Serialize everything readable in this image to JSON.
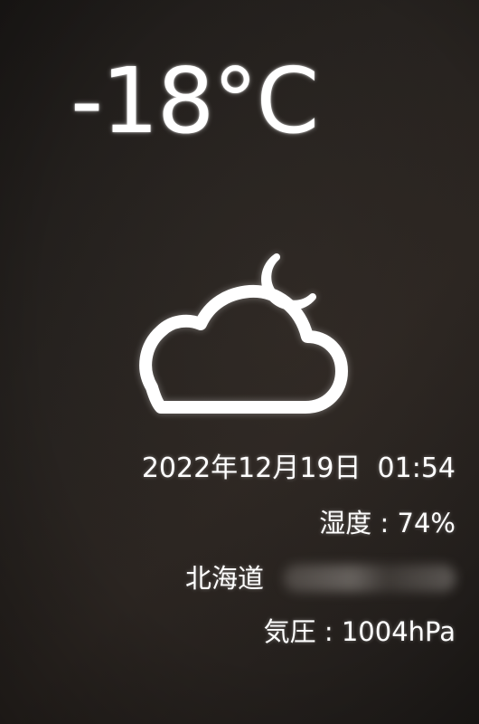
{
  "weather": {
    "temperature": "-18°C",
    "condition_icon": "cloud-moon-icon",
    "date": "2022年12月19日",
    "time": "01:54",
    "humidity_label": "湿度",
    "humidity_value": "74%",
    "location": "北海道",
    "pressure_label": "気圧",
    "pressure_value": "1004hPa"
  },
  "colors": {
    "text": "#ffffff",
    "background": "#26221f"
  }
}
